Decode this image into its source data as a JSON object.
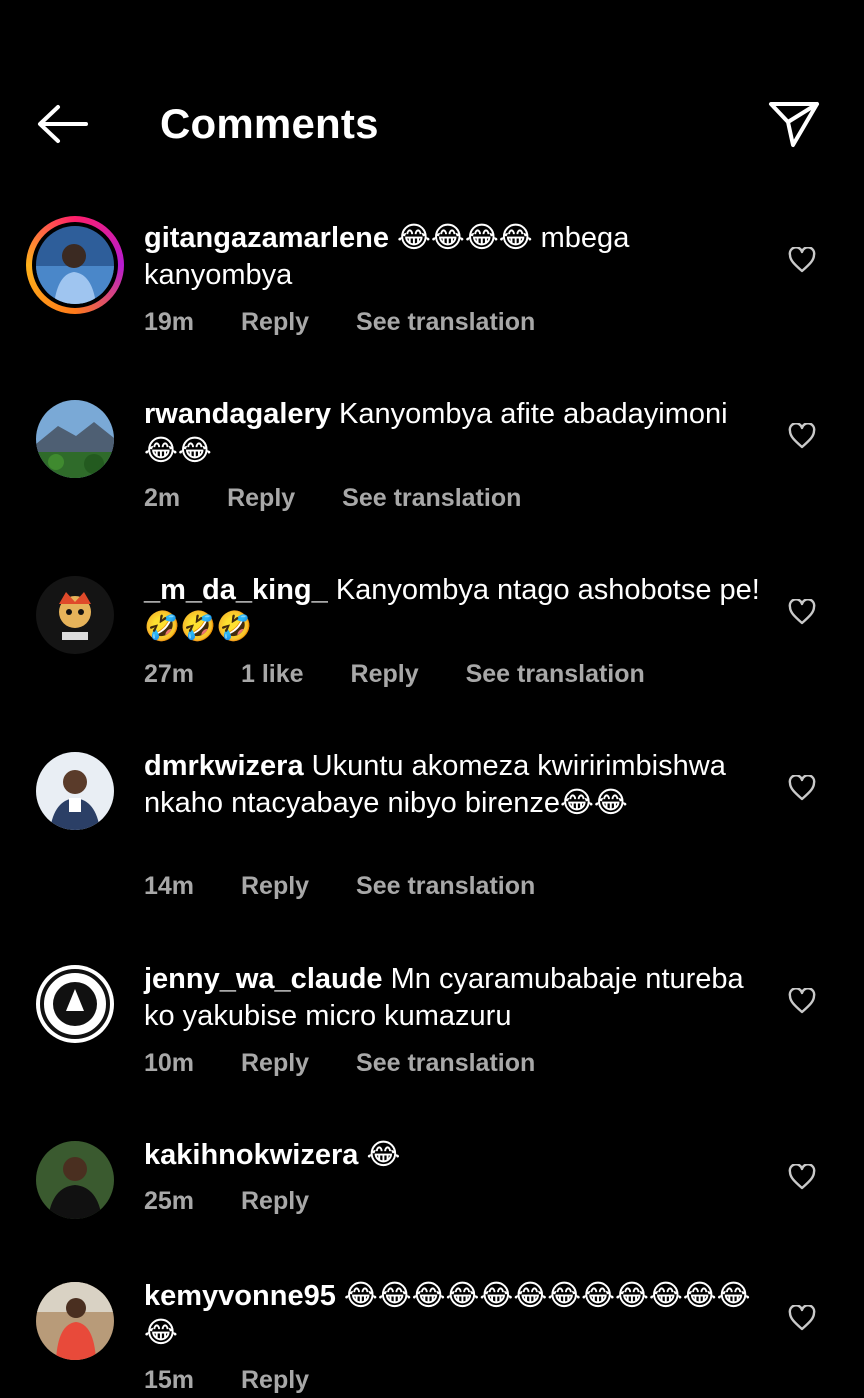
{
  "header": {
    "title": "Comments"
  },
  "icons": {
    "back": "arrow-left-icon",
    "share": "paper-plane-icon",
    "like": "heart-outline-icon"
  },
  "comments": [
    {
      "username": "gitangazamarlene",
      "text": "😂😂😂😂 mbega kanyombya",
      "time": "19m",
      "likes": "",
      "reply": "Reply",
      "translate": "See translation"
    },
    {
      "username": "rwandagalery",
      "text": "Kanyombya afite abadayimoni 😂😂",
      "time": "2m",
      "likes": "",
      "reply": "Reply",
      "translate": "See translation"
    },
    {
      "username": "_m_da_king_",
      "text": "Kanyombya ntago ashobotse pe! 🤣🤣🤣",
      "time": "27m",
      "likes": "1 like",
      "reply": "Reply",
      "translate": "See translation"
    },
    {
      "username": "dmrkwizera",
      "text": "Ukuntu akomeza kwiririmbishwa nkaho ntacyabaye nibyo birenze😂😂",
      "time": "14m",
      "likes": "",
      "reply": "Reply",
      "translate": "See translation"
    },
    {
      "username": "jenny_wa_claude",
      "text": "Mn cyaramubabaje ntureba ko yakubise micro kumazuru",
      "time": "10m",
      "likes": "",
      "reply": "Reply",
      "translate": "See translation"
    },
    {
      "username": "kakihnokwizera",
      "text": "😂",
      "time": "25m",
      "likes": "",
      "reply": "Reply",
      "translate": ""
    },
    {
      "username": "kemyvonne95",
      "text": "😂😂😂😂😂😂😂😂😂😂😂😂😂",
      "time": "15m",
      "likes": "",
      "reply": "Reply",
      "translate": ""
    }
  ]
}
